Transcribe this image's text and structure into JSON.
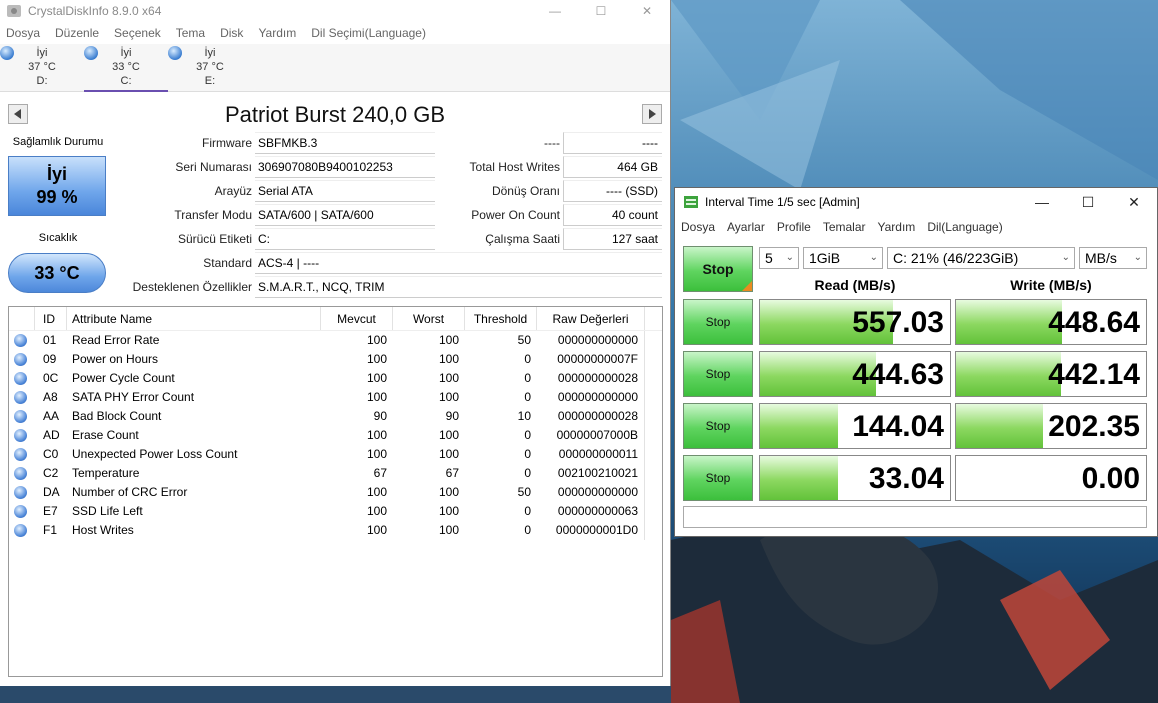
{
  "cdi": {
    "title": "CrystalDiskInfo 8.9.0 x64",
    "menu": [
      "Dosya",
      "Düzenle",
      "Seçenek",
      "Tema",
      "Disk",
      "Yardım",
      "Dil Seçimi(Language)"
    ],
    "drives": [
      {
        "status": "İyi",
        "temp": "37 °C",
        "letter": "D:"
      },
      {
        "status": "İyi",
        "temp": "33 °C",
        "letter": "C:"
      },
      {
        "status": "İyi",
        "temp": "37 °C",
        "letter": "E:"
      }
    ],
    "model": "Patriot Burst 240,0 GB",
    "health_label": "Sağlamlık Durumu",
    "health_status": "İyi",
    "health_pct": "99 %",
    "temp_label": "Sıcaklık",
    "temp_value": "33 °C",
    "left_fields": [
      {
        "label": "Firmware",
        "value": "SBFMKB.3"
      },
      {
        "label": "Seri Numarası",
        "value": "306907080B9400102253"
      },
      {
        "label": "Arayüz",
        "value": "Serial ATA"
      },
      {
        "label": "Transfer Modu",
        "value": "SATA/600 | SATA/600"
      },
      {
        "label": "Sürücü Etiketi",
        "value": "C:"
      },
      {
        "label": "Standard",
        "value": "ACS-4 | ----"
      },
      {
        "label": "Desteklenen Özellikler",
        "value": "S.M.A.R.T., NCQ, TRIM"
      }
    ],
    "right_fields": [
      {
        "label": "----",
        "value": "----"
      },
      {
        "label": "Total Host Writes",
        "value": "464 GB"
      },
      {
        "label": "Dönüş Oranı",
        "value": "---- (SSD)"
      },
      {
        "label": "Power On Count",
        "value": "40 count"
      },
      {
        "label": "Çalışma Saati",
        "value": "127 saat"
      }
    ],
    "attr_headers": {
      "id": "ID",
      "name": "Attribute Name",
      "current": "Mevcut",
      "worst": "Worst",
      "threshold": "Threshold",
      "raw": "Raw Değerleri"
    },
    "attributes": [
      {
        "id": "01",
        "name": "Read Error Rate",
        "current": "100",
        "worst": "100",
        "threshold": "50",
        "raw": "000000000000"
      },
      {
        "id": "09",
        "name": "Power on Hours",
        "current": "100",
        "worst": "100",
        "threshold": "0",
        "raw": "00000000007F"
      },
      {
        "id": "0C",
        "name": "Power Cycle Count",
        "current": "100",
        "worst": "100",
        "threshold": "0",
        "raw": "000000000028"
      },
      {
        "id": "A8",
        "name": "SATA PHY Error Count",
        "current": "100",
        "worst": "100",
        "threshold": "0",
        "raw": "000000000000"
      },
      {
        "id": "AA",
        "name": "Bad Block Count",
        "current": "90",
        "worst": "90",
        "threshold": "10",
        "raw": "000000000028"
      },
      {
        "id": "AD",
        "name": "Erase Count",
        "current": "100",
        "worst": "100",
        "threshold": "0",
        "raw": "00000007000B"
      },
      {
        "id": "C0",
        "name": "Unexpected Power Loss Count",
        "current": "100",
        "worst": "100",
        "threshold": "0",
        "raw": "000000000011"
      },
      {
        "id": "C2",
        "name": "Temperature",
        "current": "67",
        "worst": "67",
        "threshold": "0",
        "raw": "002100210021"
      },
      {
        "id": "DA",
        "name": "Number of CRC Error",
        "current": "100",
        "worst": "100",
        "threshold": "50",
        "raw": "000000000000"
      },
      {
        "id": "E7",
        "name": "SSD Life Left",
        "current": "100",
        "worst": "100",
        "threshold": "0",
        "raw": "000000000063"
      },
      {
        "id": "F1",
        "name": "Host Writes",
        "current": "100",
        "worst": "100",
        "threshold": "0",
        "raw": "0000000001D0"
      }
    ]
  },
  "cdm": {
    "title": "Interval Time 1/5 sec [Admin]",
    "menu": [
      "Dosya",
      "Ayarlar",
      "Profile",
      "Temalar",
      "Yardım",
      "Dil(Language)"
    ],
    "stop_all_label": "Stop",
    "count_select": "5",
    "size_select": "1GiB",
    "drive_select": "C: 21% (46/223GiB)",
    "unit_select": "MB/s",
    "read_header": "Read (MB/s)",
    "write_header": "Write (MB/s)",
    "rows": [
      {
        "button": "Stop",
        "read": "557.03",
        "read_pct": 0.7,
        "write": "448.64",
        "write_pct": 0.56
      },
      {
        "button": "Stop",
        "read": "444.63",
        "read_pct": 0.61,
        "write": "442.14",
        "write_pct": 0.55
      },
      {
        "button": "Stop",
        "read": "144.04",
        "read_pct": 0.41,
        "write": "202.35",
        "write_pct": 0.46
      },
      {
        "button": "Stop",
        "read": "33.04",
        "read_pct": 0.41,
        "write": "0.00",
        "write_pct": 0.0
      }
    ],
    "status_text": ""
  },
  "colors": {
    "accent_tab": "#6a4fb0",
    "health_blue": "#6fa6eb",
    "meter_green": "#8cd860",
    "stop_orange": "#e98b20"
  }
}
